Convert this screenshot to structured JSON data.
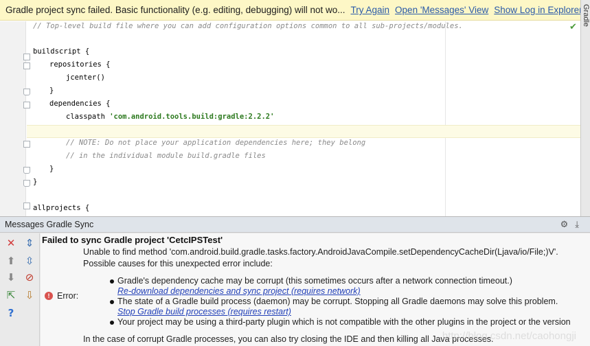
{
  "notification": {
    "message": "Gradle project sync failed. Basic functionality (e.g. editing, debugging) will not wo...",
    "links": [
      "Try Again",
      "Open 'Messages' View",
      "Show Log in Explorer"
    ]
  },
  "side_tab": {
    "label": "Gradle"
  },
  "editor": {
    "lines": {
      "l1": "// Top-level build file where you can add configuration options common to all sub-projects/modules.",
      "l2": "buildscript {",
      "l3": "repositories {",
      "l4": "jcenter()",
      "l5": "}",
      "l6": "dependencies {",
      "l7_prefix": "classpath ",
      "l7_string": "'com.android.tools.build:gradle:2.2.2'",
      "l8": "// NOTE: Do not place your application dependencies here; they belong",
      "l9": "// in the individual module build.gradle files",
      "l10": "}",
      "l11": "}",
      "l12": "allprojects {"
    }
  },
  "messages": {
    "panel_title": "Messages Gradle Sync",
    "header": "Failed to sync Gradle project 'CetcIPSTest'",
    "error_label": "Error:",
    "line1": "Unable to find method 'com.android.build.gradle.tasks.factory.AndroidJavaCompile.setDependencyCacheDir(Ljava/io/File;)V'.",
    "line2": "Possible causes for this unexpected error include:",
    "bullet1": "Gradle's dependency cache may be corrupt (this sometimes occurs after a network connection timeout.)",
    "link1": "Re-download dependencies and sync project (requires network)",
    "bullet2": "The state of a Gradle build process (daemon) may be corrupt. Stopping all Gradle daemons may solve this problem.",
    "link2": "Stop Gradle build processes (requires restart)",
    "bullet3": "Your project may be using a third-party plugin which is not compatible with the other plugins in the project or the version",
    "line_last": "In the case of corrupt Gradle processes, you can also try closing the IDE and then killing all Java processes.",
    "watermark": "http://blog.csdn.net/caohongji"
  },
  "colors": {
    "notification_bg": "#fdf7c6",
    "link": "#2a5aa8",
    "error": "#d9534f",
    "string": "#2d7a1f",
    "comment": "#8a8a8a"
  },
  "icons": {
    "toolbar": [
      "close-icon",
      "expand-all-icon",
      "up-arrow-icon",
      "collapse-all-icon",
      "down-arrow-icon",
      "error-filter-icon",
      "export-icon",
      "import-icon",
      "help-icon"
    ],
    "header_tools": [
      "gear-icon",
      "pin-icon"
    ]
  }
}
